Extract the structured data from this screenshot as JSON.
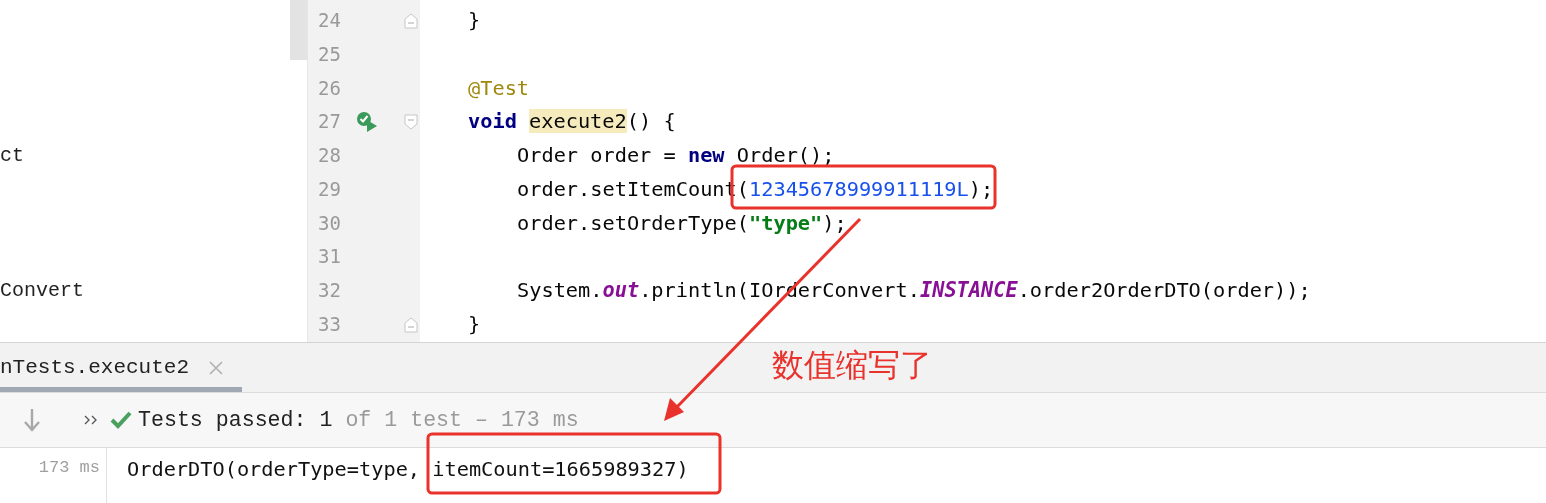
{
  "project_tree": [
    {
      "text": "ct"
    },
    {
      "text": "Convert"
    }
  ],
  "editor": {
    "lines": [
      {
        "number": "24",
        "fold_marker": true,
        "run": false,
        "tokens": [
          {
            "kind": "plain",
            "text": "}"
          }
        ]
      },
      {
        "number": "25",
        "fold_marker": false,
        "run": false
      },
      {
        "number": "26",
        "fold_marker": false,
        "run": false,
        "tokens": [
          {
            "kind": "annotation",
            "text": "@Test"
          }
        ]
      },
      {
        "number": "27",
        "fold_marker": true,
        "run": true,
        "tokens": [
          {
            "kind": "keyword",
            "text": "void "
          },
          {
            "kind": "highlight",
            "text": "execute2"
          },
          {
            "kind": "plain",
            "text": "() {"
          }
        ],
        "children": [
          {
            "number": "28",
            "fold_marker": false,
            "run": false,
            "tokens": [
              {
                "kind": "plain",
                "text": "Order order = "
              },
              {
                "kind": "keyword",
                "text": "new"
              },
              {
                "kind": "plain",
                "text": " Order();"
              }
            ]
          },
          {
            "number": "29",
            "fold_marker": false,
            "run": false,
            "tokens": [
              {
                "kind": "plain",
                "text": "order.setItemCount("
              },
              {
                "kind": "number",
                "text": "12345678999911119L"
              },
              {
                "kind": "plain",
                "text": ");"
              }
            ]
          },
          {
            "number": "30",
            "fold_marker": false,
            "run": false,
            "tokens": [
              {
                "kind": "plain",
                "text": "order.setOrderType("
              },
              {
                "kind": "string",
                "text": "\"type\""
              },
              {
                "kind": "plain",
                "text": ");"
              }
            ]
          },
          {
            "number": "31",
            "fold_marker": false,
            "run": false
          },
          {
            "number": "32",
            "fold_marker": false,
            "run": false,
            "tokens": [
              {
                "kind": "plain",
                "text": "System."
              },
              {
                "kind": "static",
                "text": "out"
              },
              {
                "kind": "plain",
                "text": ".println(IOrderConvert."
              },
              {
                "kind": "static",
                "text": "INSTANCE"
              },
              {
                "kind": "plain",
                "text": ".order2OrderDTO(order));"
              }
            ]
          }
        ]
      },
      {
        "number": "33",
        "fold_marker": true,
        "run": false,
        "tokens": [
          {
            "kind": "plain",
            "text": "}"
          }
        ]
      }
    ]
  },
  "run_panel": {
    "tab": {
      "label": "nTests.execute2",
      "selected": true
    },
    "status": {
      "passed": "Tests passed: 1",
      "detail": "of 1 test – 173 ms"
    },
    "output": {
      "time": "173 ms",
      "text": "OrderDTO(orderType=type, itemCount=1665989327)"
    }
  },
  "annotation": {
    "text": "数值缩写了"
  }
}
